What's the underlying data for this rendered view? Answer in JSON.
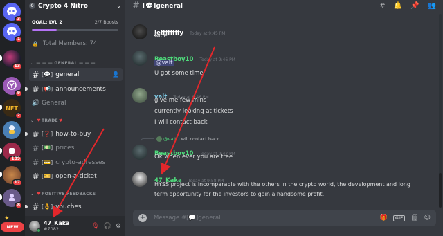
{
  "colors": {
    "accent": "#5865f2",
    "danger": "#ed4245",
    "online": "#3ba55d",
    "green_name": "#4fdc7c",
    "arrow": "#e3272b"
  },
  "rail": {
    "servers": [
      {
        "initials": "",
        "badge": "3",
        "color": "#5865f2",
        "icon": "discord-icon"
      },
      {
        "initials": "",
        "badge": "1",
        "color": "#5865f2",
        "icon": "discord-icon"
      },
      {
        "initials": "",
        "badge": "13",
        "color": "#1b1b2f",
        "icon": "server-icon"
      },
      {
        "initials": "",
        "badge": "9",
        "color": "#9b59b6",
        "icon": "server-icon"
      },
      {
        "initials": "NFT",
        "badge": "2",
        "color": "#3a2a15",
        "icon": "server-icon"
      },
      {
        "initials": "",
        "badge": "",
        "color": "#4a7fb5",
        "icon": "server-icon"
      },
      {
        "initials": "",
        "badge": "189",
        "color": "#9c2a4a",
        "icon": "server-icon"
      },
      {
        "initials": "",
        "badge": "17",
        "color": "#6b3d2a",
        "icon": "server-icon"
      },
      {
        "initials": "",
        "badge": "8",
        "color": "#6a5a8a",
        "icon": "server-icon"
      }
    ],
    "new_label": "NEW"
  },
  "server": {
    "level_badge": "0",
    "name": "Crypto 4 Nitro",
    "goal_label": "GOAL: LVL 2",
    "boosts": "2/7 Boosts",
    "boost_progress": 0.29,
    "members": "Total Members: 74"
  },
  "categories": {
    "general": "— — — GENERAL — — —",
    "trade": "TRADE",
    "positive": "POSITIVE FEEDBACKS"
  },
  "channels": [
    {
      "name": "general",
      "emoji": "[💬]",
      "hash": "#"
    },
    {
      "name": "announcements",
      "emoji": "[📢]",
      "hash": "#"
    },
    {
      "name": "General",
      "emoji": "",
      "hash": "🔊"
    },
    {
      "name": "how-to-buy",
      "emoji": "[❓]",
      "hash": "#"
    },
    {
      "name": "prices",
      "emoji": "[💵]",
      "hash": "#"
    },
    {
      "name": "crypto-adresses",
      "emoji": "[💳]",
      "hash": "#"
    },
    {
      "name": "open-a-ticket",
      "emoji": "[🎫]",
      "hash": "#"
    },
    {
      "name": "vouches",
      "emoji": "[👌]",
      "hash": "#"
    }
  ],
  "user": {
    "name": "47_Kaka",
    "tag": "#7082"
  },
  "header": {
    "title": "[💬]general"
  },
  "messages": [
    {
      "author": "Jeffffffffy",
      "time": "Today at 9:45 PM",
      "lines": [
        "Nice"
      ],
      "color": "#ffffff"
    },
    {
      "author": "Beastboy10",
      "time": "Today at 9:46 PM",
      "mention": "@valt",
      "lines": [
        "U got some time"
      ],
      "color": "#4fdc7c"
    },
    {
      "author": "valt",
      "time": "Today at 9:46 PM",
      "lines": [
        "give me few mins",
        "currently looking at tickets",
        "I will contact back"
      ],
      "color": "#7ec8e3"
    },
    {
      "author": "Beastboy10",
      "time": "Today at 9:47 PM",
      "reply_author": "@valt",
      "reply_text": "I will contact back",
      "lines": [
        "Ok when ever you are free"
      ],
      "color": "#4fdc7c"
    },
    {
      "author": "47_Kaka",
      "time": "Today at 9:58 PM",
      "lines": [
        "HYSS project is incomparable with the others in the crypto world, the development and long",
        "term opportunity for the investors to gain a handsome profit."
      ],
      "color": "#4fdc7c"
    }
  ],
  "composer": {
    "placeholder": "Message #[💬]general",
    "gif_label": "GIF"
  }
}
